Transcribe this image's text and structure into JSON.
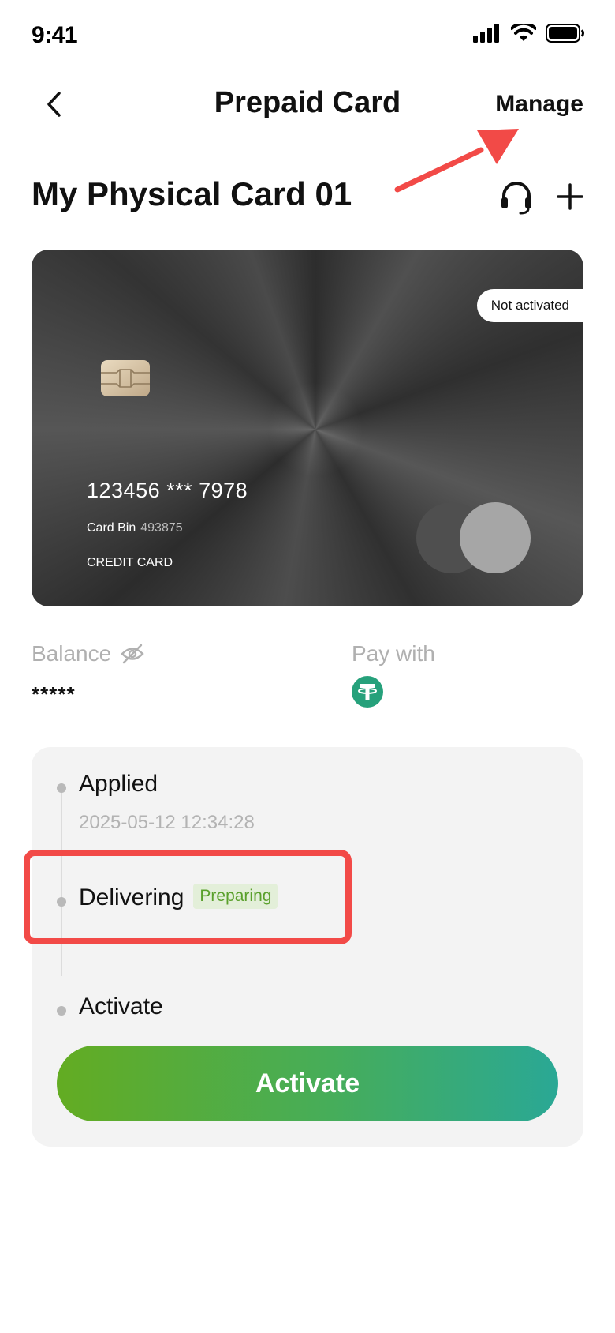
{
  "status_bar": {
    "time": "9:41",
    "icons": [
      "cellular-signal-icon",
      "wifi-icon",
      "battery-icon"
    ]
  },
  "nav": {
    "title": "Prepaid Card",
    "manage_label": "Manage",
    "back_icon": "chevron-left-icon"
  },
  "card_header": {
    "name": "My Physical Card 01",
    "icons": [
      "headset-icon",
      "plus-icon"
    ]
  },
  "card": {
    "status": "Not activated",
    "number": "123456 *** 7978",
    "bin_label": "Card Bin",
    "bin_value": "493875",
    "type": "CREDIT CARD"
  },
  "balance": {
    "label": "Balance",
    "value": "*****",
    "icon": "eye-off-icon"
  },
  "pay_with": {
    "label": "Pay with",
    "icon": "tether-usdt-icon"
  },
  "progress": {
    "steps": [
      {
        "title": "Applied",
        "date": "2025-05-12 12:34:28"
      },
      {
        "title": "Delivering",
        "badge": "Preparing"
      },
      {
        "title": "Activate"
      }
    ],
    "activate_button": "Activate"
  },
  "colors": {
    "annotation_red": "#f24a47",
    "button_gradient_start": "#63ac22",
    "button_gradient_end": "#2aa895",
    "preparing_text": "#5aa02c",
    "tether_green": "#26a17b"
  }
}
